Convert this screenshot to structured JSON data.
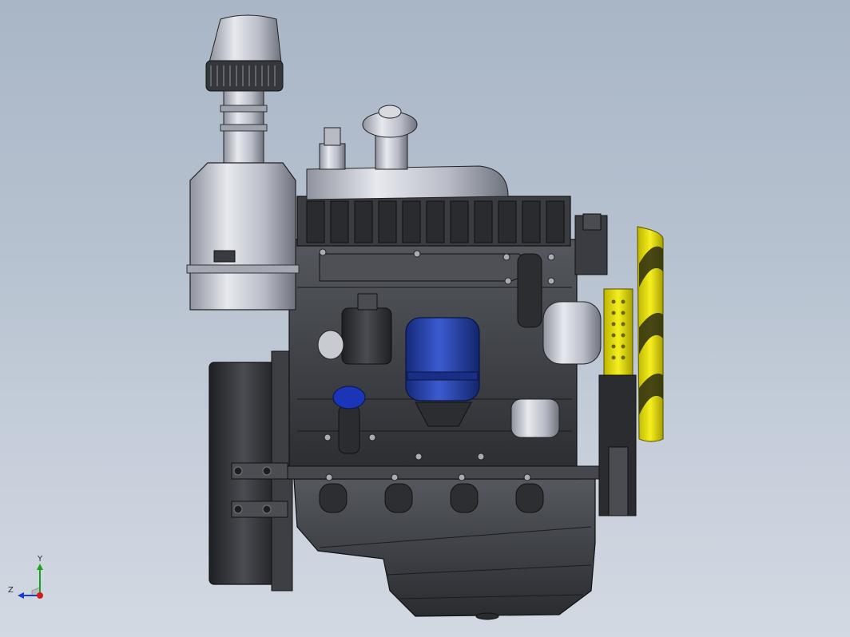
{
  "viewport": {
    "background_top": "#a9b6c6",
    "background_bottom": "#d3d9e2"
  },
  "model": {
    "colors": {
      "metal_light": "#c9ccd6",
      "metal_dark": "#2e3034",
      "block": "#3c3e42",
      "filter_blue": "#1f3a9e",
      "cap_blue": "#1a35b8",
      "fan_yellow": "#e8e000"
    },
    "icons": [
      "air-cleaner",
      "engine-block",
      "oil-filter",
      "oil-filler-cap",
      "cooling-fan",
      "flywheel-housing",
      "oil-pan"
    ]
  },
  "triad": {
    "y_label": "Y",
    "z_label": "Z",
    "y_color": "#1aa41a",
    "x_color": "#1a3ad0",
    "origin_color": "#d21c1c"
  }
}
